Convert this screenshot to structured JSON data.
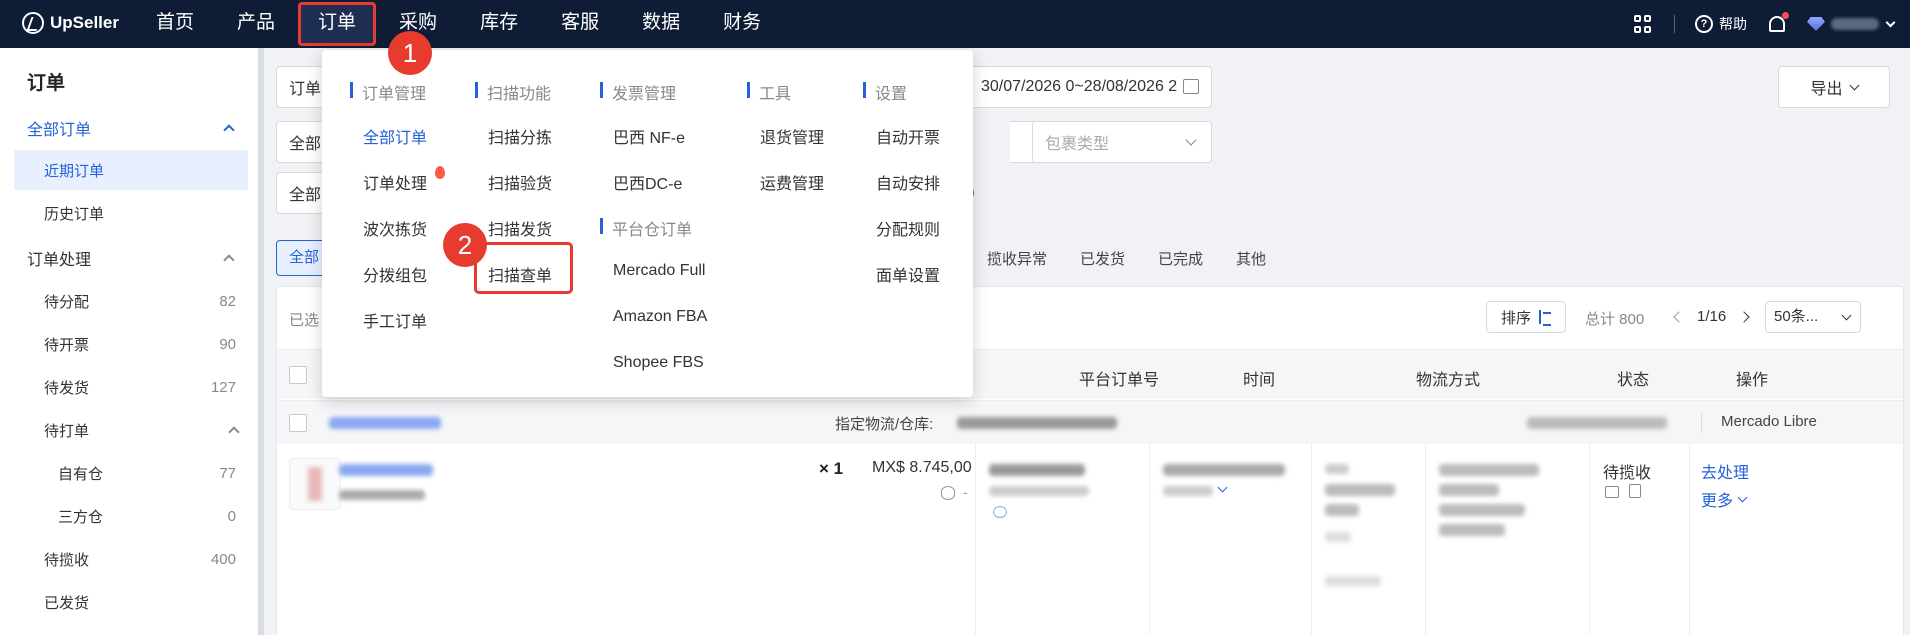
{
  "brand": {
    "name": "UpSeller"
  },
  "nav": {
    "items": [
      "首页",
      "产品",
      "订单",
      "采购",
      "库存",
      "客服",
      "数据",
      "财务"
    ],
    "active_index": 2,
    "help_label": "帮助"
  },
  "sidebar": {
    "title": "订单",
    "groups": [
      {
        "label": "全部订单",
        "items": [
          {
            "label": "近期订单",
            "count": ""
          },
          {
            "label": "历史订单",
            "count": ""
          }
        ]
      },
      {
        "label": "订单处理",
        "items": [
          {
            "label": "待分配",
            "count": "82"
          },
          {
            "label": "待开票",
            "count": "90"
          },
          {
            "label": "待发货",
            "count": "127"
          },
          {
            "label": "待打单",
            "count": ""
          },
          {
            "label": "自有仓",
            "count": "77"
          },
          {
            "label": "三方仓",
            "count": "0"
          },
          {
            "label": "待揽收",
            "count": "400"
          },
          {
            "label": "已发货",
            "count": ""
          }
        ]
      }
    ]
  },
  "filters": {
    "f1": "订单",
    "date_range": "30/07/2026 0~28/08/2026 2",
    "f2": "全部",
    "package_type_placeholder": "包裹类型",
    "f3": "全部",
    "export_label": "导出"
  },
  "tabs": {
    "first": "全部",
    "items": [
      "揽收异常",
      "已发货",
      "已完成",
      "其他"
    ]
  },
  "table": {
    "selected_label": "已选",
    "sort_label": "排序",
    "total_label": "总计 800",
    "page": "1/16",
    "page_size": "50条...",
    "headers": [
      "平台订单号",
      "时间",
      "物流方式",
      "状态",
      "操作"
    ],
    "order": {
      "warehouse_label": "指定物流/仓库:",
      "platform": "Mercado Libre",
      "quantity": "× 1",
      "amount": "MX$ 8.745,00",
      "amount_sub": "-",
      "status": "待揽收",
      "action": "去处理",
      "more": "更多"
    }
  },
  "mega_menu": {
    "columns": [
      {
        "header": "订单管理",
        "items": [
          "全部订单",
          "订单处理",
          "波次拣货",
          "分拨组包",
          "手工订单"
        ]
      },
      {
        "header": "扫描功能",
        "items": [
          "扫描分拣",
          "扫描验货",
          "扫描发货",
          "扫描查单"
        ]
      },
      {
        "header": "发票管理",
        "items": [
          "巴西 NF-e",
          "巴西DC-e"
        ]
      },
      {
        "header": "平台仓订单",
        "items": [
          "Mercado Full",
          "Amazon FBA",
          "Shopee FBS"
        ]
      },
      {
        "header": "工具",
        "items": [
          "退货管理",
          "运费管理"
        ]
      },
      {
        "header": "设置",
        "items": [
          "自动开票",
          "自动安排",
          "分配规则",
          "面单设置"
        ]
      }
    ]
  },
  "step_badges": [
    "1",
    "2"
  ],
  "colors": {
    "nav_bg": "#0e1c36",
    "accent": "#2463d6",
    "highlight": "#e63b2e"
  }
}
